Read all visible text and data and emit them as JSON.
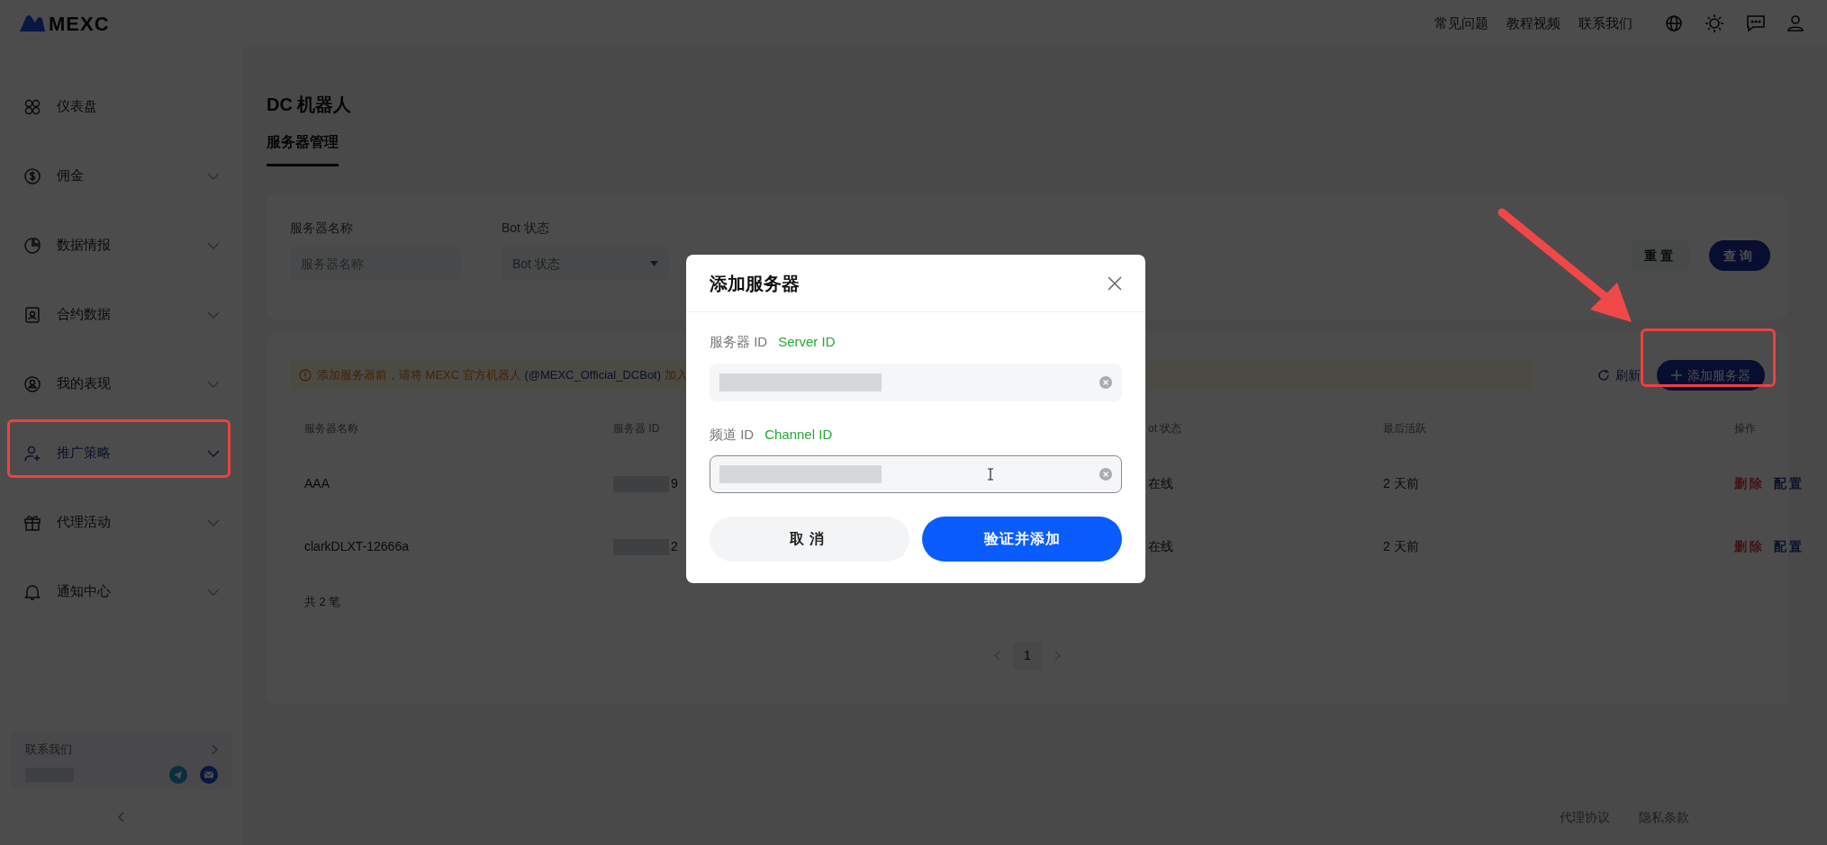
{
  "header": {
    "logo": "MEXC",
    "links": [
      "常见问题",
      "教程视频",
      "联系我们"
    ]
  },
  "sidebar": {
    "items": [
      {
        "label": "仪表盘",
        "selected": false,
        "expandable": false
      },
      {
        "label": "佣金",
        "selected": false,
        "expandable": true
      },
      {
        "label": "数据情报",
        "selected": false,
        "expandable": true
      },
      {
        "label": "合约数据",
        "selected": false,
        "expandable": true
      },
      {
        "label": "我的表现",
        "selected": false,
        "expandable": true
      },
      {
        "label": "推广策略",
        "selected": true,
        "expandable": true
      },
      {
        "label": "代理活动",
        "selected": false,
        "expandable": true
      },
      {
        "label": "通知中心",
        "selected": false,
        "expandable": true
      }
    ],
    "contact": "联系我们"
  },
  "page": {
    "title": "DC 机器人",
    "tabs": [
      {
        "label": "服务器管理",
        "selected": true
      }
    ]
  },
  "filters": {
    "fields": [
      {
        "kind": "input",
        "label": "服务器名称",
        "placeholder": "服务器名称"
      },
      {
        "kind": "select",
        "label": "Bot 状态",
        "placeholder": "Bot 状态"
      }
    ],
    "buttons": [
      {
        "label": "重置",
        "kind": "secondary"
      },
      {
        "label": "查询",
        "kind": "primary"
      }
    ]
  },
  "table": {
    "notice": {
      "text": "添加服务器前，请将 MEXC 官方机器人",
      "link": "(@MEXC_Official_DCBot)",
      "tail": "加入"
    },
    "refresh": "刷新",
    "add_button": "添加服务器",
    "columns": [
      "服务器名称",
      "服务器 ID",
      "ot 状态",
      "最后活跃",
      "操作"
    ],
    "rows": [
      {
        "name": "AAA",
        "id": "9",
        "status": "在线",
        "last_active": "2 天前",
        "actions": [
          {
            "label": "删除",
            "kind": "danger"
          },
          {
            "label": "配置",
            "kind": "link"
          }
        ]
      },
      {
        "name": "clarkDLXT-12666a",
        "id": "2",
        "status": "在线",
        "last_active": "2 天前",
        "actions": [
          {
            "label": "删除",
            "kind": "danger"
          },
          {
            "label": "配置",
            "kind": "link"
          }
        ]
      }
    ],
    "total": "共 2 笔",
    "pages": [
      {
        "label": "1",
        "selected": true
      }
    ]
  },
  "footer_links": [
    "代理协议",
    "隐私条款"
  ],
  "dialog": {
    "title": "添加服务器",
    "fields": [
      {
        "label": "服务器 ID",
        "hint": "Server ID",
        "focused": false
      },
      {
        "label": "频道 ID",
        "hint": "Channel ID",
        "focused": true
      }
    ],
    "buttons": [
      {
        "label": "取消",
        "kind": "secondary"
      },
      {
        "label": "验证并添加",
        "kind": "primary"
      }
    ]
  }
}
